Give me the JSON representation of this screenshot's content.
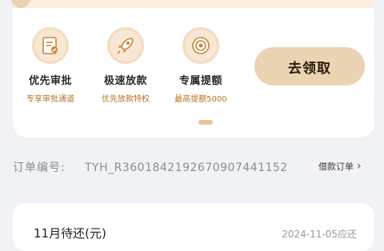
{
  "features": [
    {
      "icon": "approval-form-icon",
      "title": "优先审批",
      "subtitle": "专享审批通道"
    },
    {
      "icon": "rocket-icon",
      "title": "极速放款",
      "subtitle": "优先放款特权"
    },
    {
      "icon": "coin-icon",
      "title": "专属提额",
      "subtitle": "最高提额5000"
    }
  ],
  "claim_button": "去领取",
  "order": {
    "label": "订单编号:",
    "number": "TYH_R3601842192670907441152",
    "link": "借款订单",
    "link_icon": "chevron-right-icon"
  },
  "due": {
    "title": "11月待还(元)",
    "date": "2024-11-05应还"
  },
  "colors": {
    "accent": "#ebd4b3",
    "accent_text": "#b2762a",
    "page_bg": "#f1f2f6"
  }
}
